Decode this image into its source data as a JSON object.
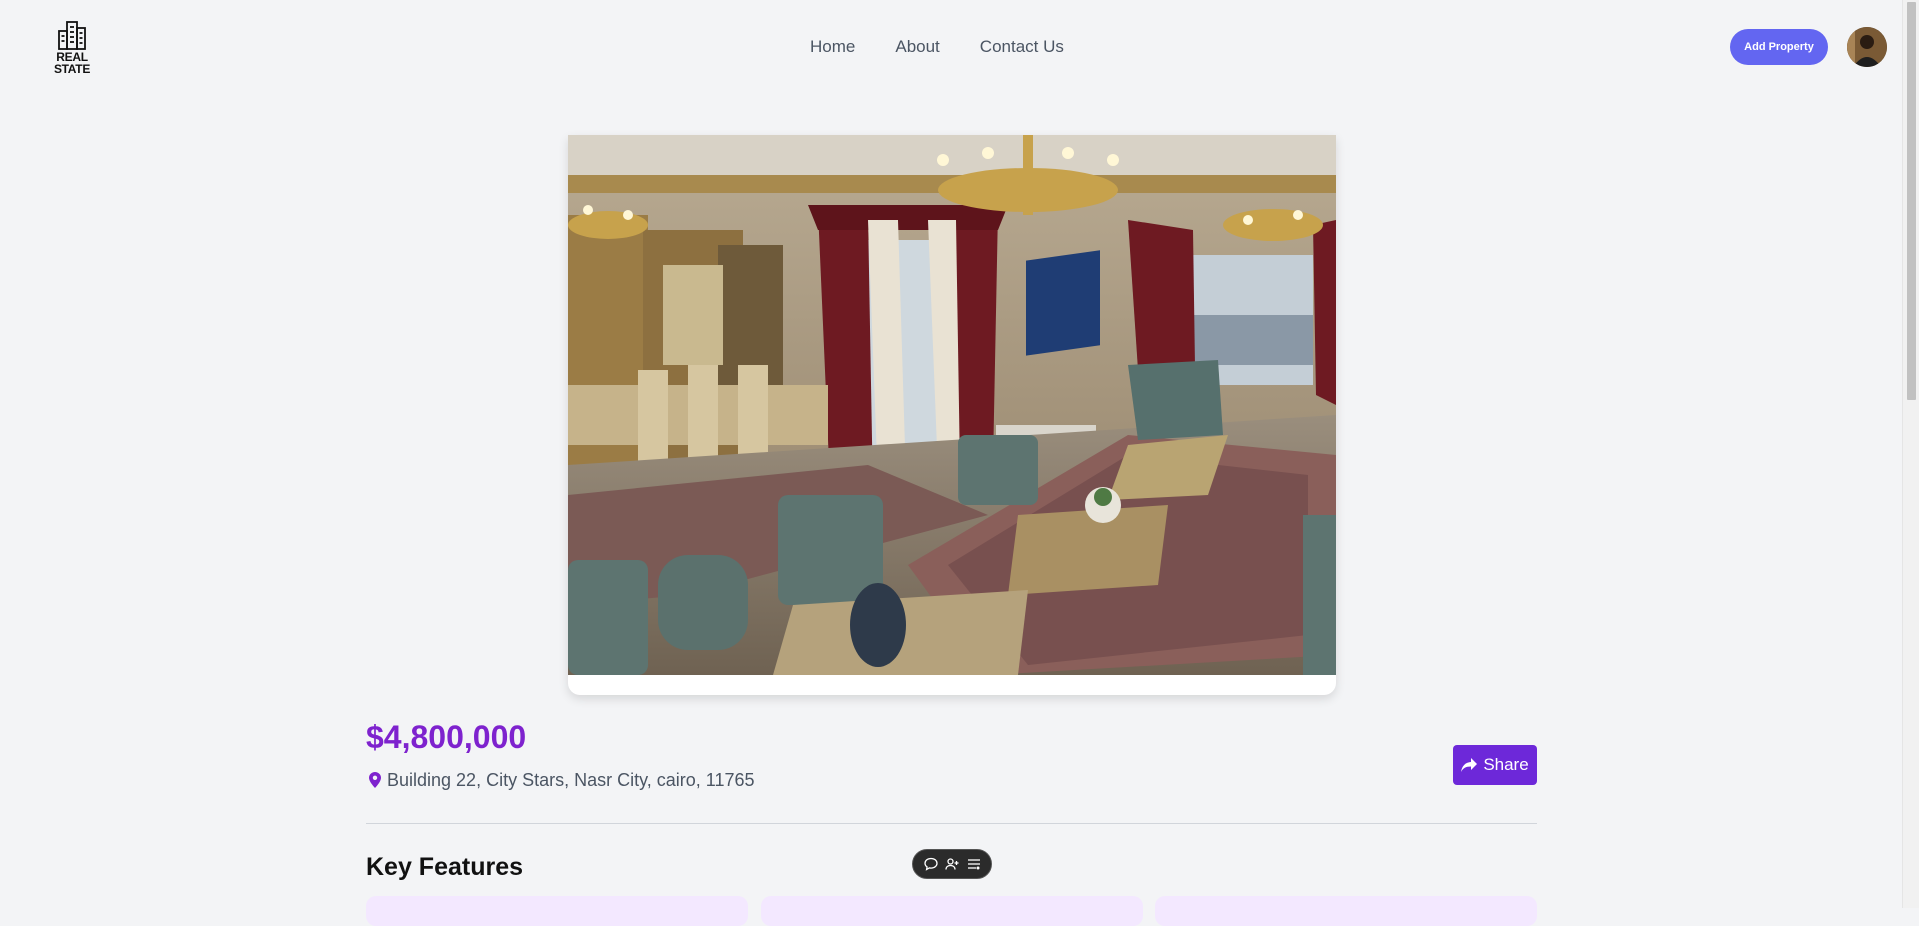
{
  "brand": {
    "logo_text": "REAL STATE"
  },
  "nav": {
    "items": [
      {
        "label": "Home"
      },
      {
        "label": "About"
      },
      {
        "label": "Contact Us"
      }
    ]
  },
  "header": {
    "add_property_label": "Add Property"
  },
  "property": {
    "price": "$4,800,000",
    "address": "Building 22, City Stars, Nasr City, cairo, 11765",
    "share_label": "Share"
  },
  "sections": {
    "key_features_title": "Key Features"
  },
  "colors": {
    "accent": "#7e22ce",
    "primary_button": "#6366f1",
    "share_button": "#6d28d9",
    "feature_card": "#f3e8ff"
  },
  "icons": {
    "logo": "buildings-icon",
    "location": "map-pin-icon",
    "share": "share-arrow-icon",
    "toolbar": [
      "chat-bubble-icon",
      "user-add-icon",
      "settings-list-icon"
    ]
  }
}
